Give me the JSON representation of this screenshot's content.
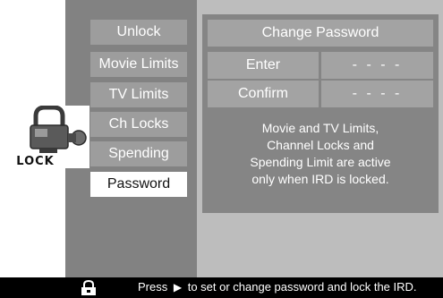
{
  "menu": {
    "items": [
      {
        "label": "Unlock"
      },
      {
        "label": "Movie Limits"
      },
      {
        "label": "TV Limits"
      },
      {
        "label": "Ch Locks"
      },
      {
        "label": "Spending"
      },
      {
        "label": "Password",
        "selected": true
      }
    ]
  },
  "lock_badge": {
    "text": "LOCK"
  },
  "dialog": {
    "title": "Change Password",
    "enter_label": "Enter",
    "enter_value": "- - - -",
    "confirm_label": "Confirm",
    "confirm_value": "- - - -",
    "info_lines": [
      "Movie and TV Limits,",
      "Channel Locks and",
      "Spending Limit are active",
      "only when IRD is locked."
    ]
  },
  "footer": {
    "hint_prefix": "Press",
    "arrow_icon": "play-arrow-icon",
    "hint_suffix": "to set or change password and lock the IRD.",
    "icon": "padlock-icon"
  },
  "colors": {
    "panel_dark": "#828282",
    "panel_light": "#bdbdbd",
    "dialog": "#858585",
    "field": "#a3a3a3",
    "selected": "#ffffff"
  }
}
